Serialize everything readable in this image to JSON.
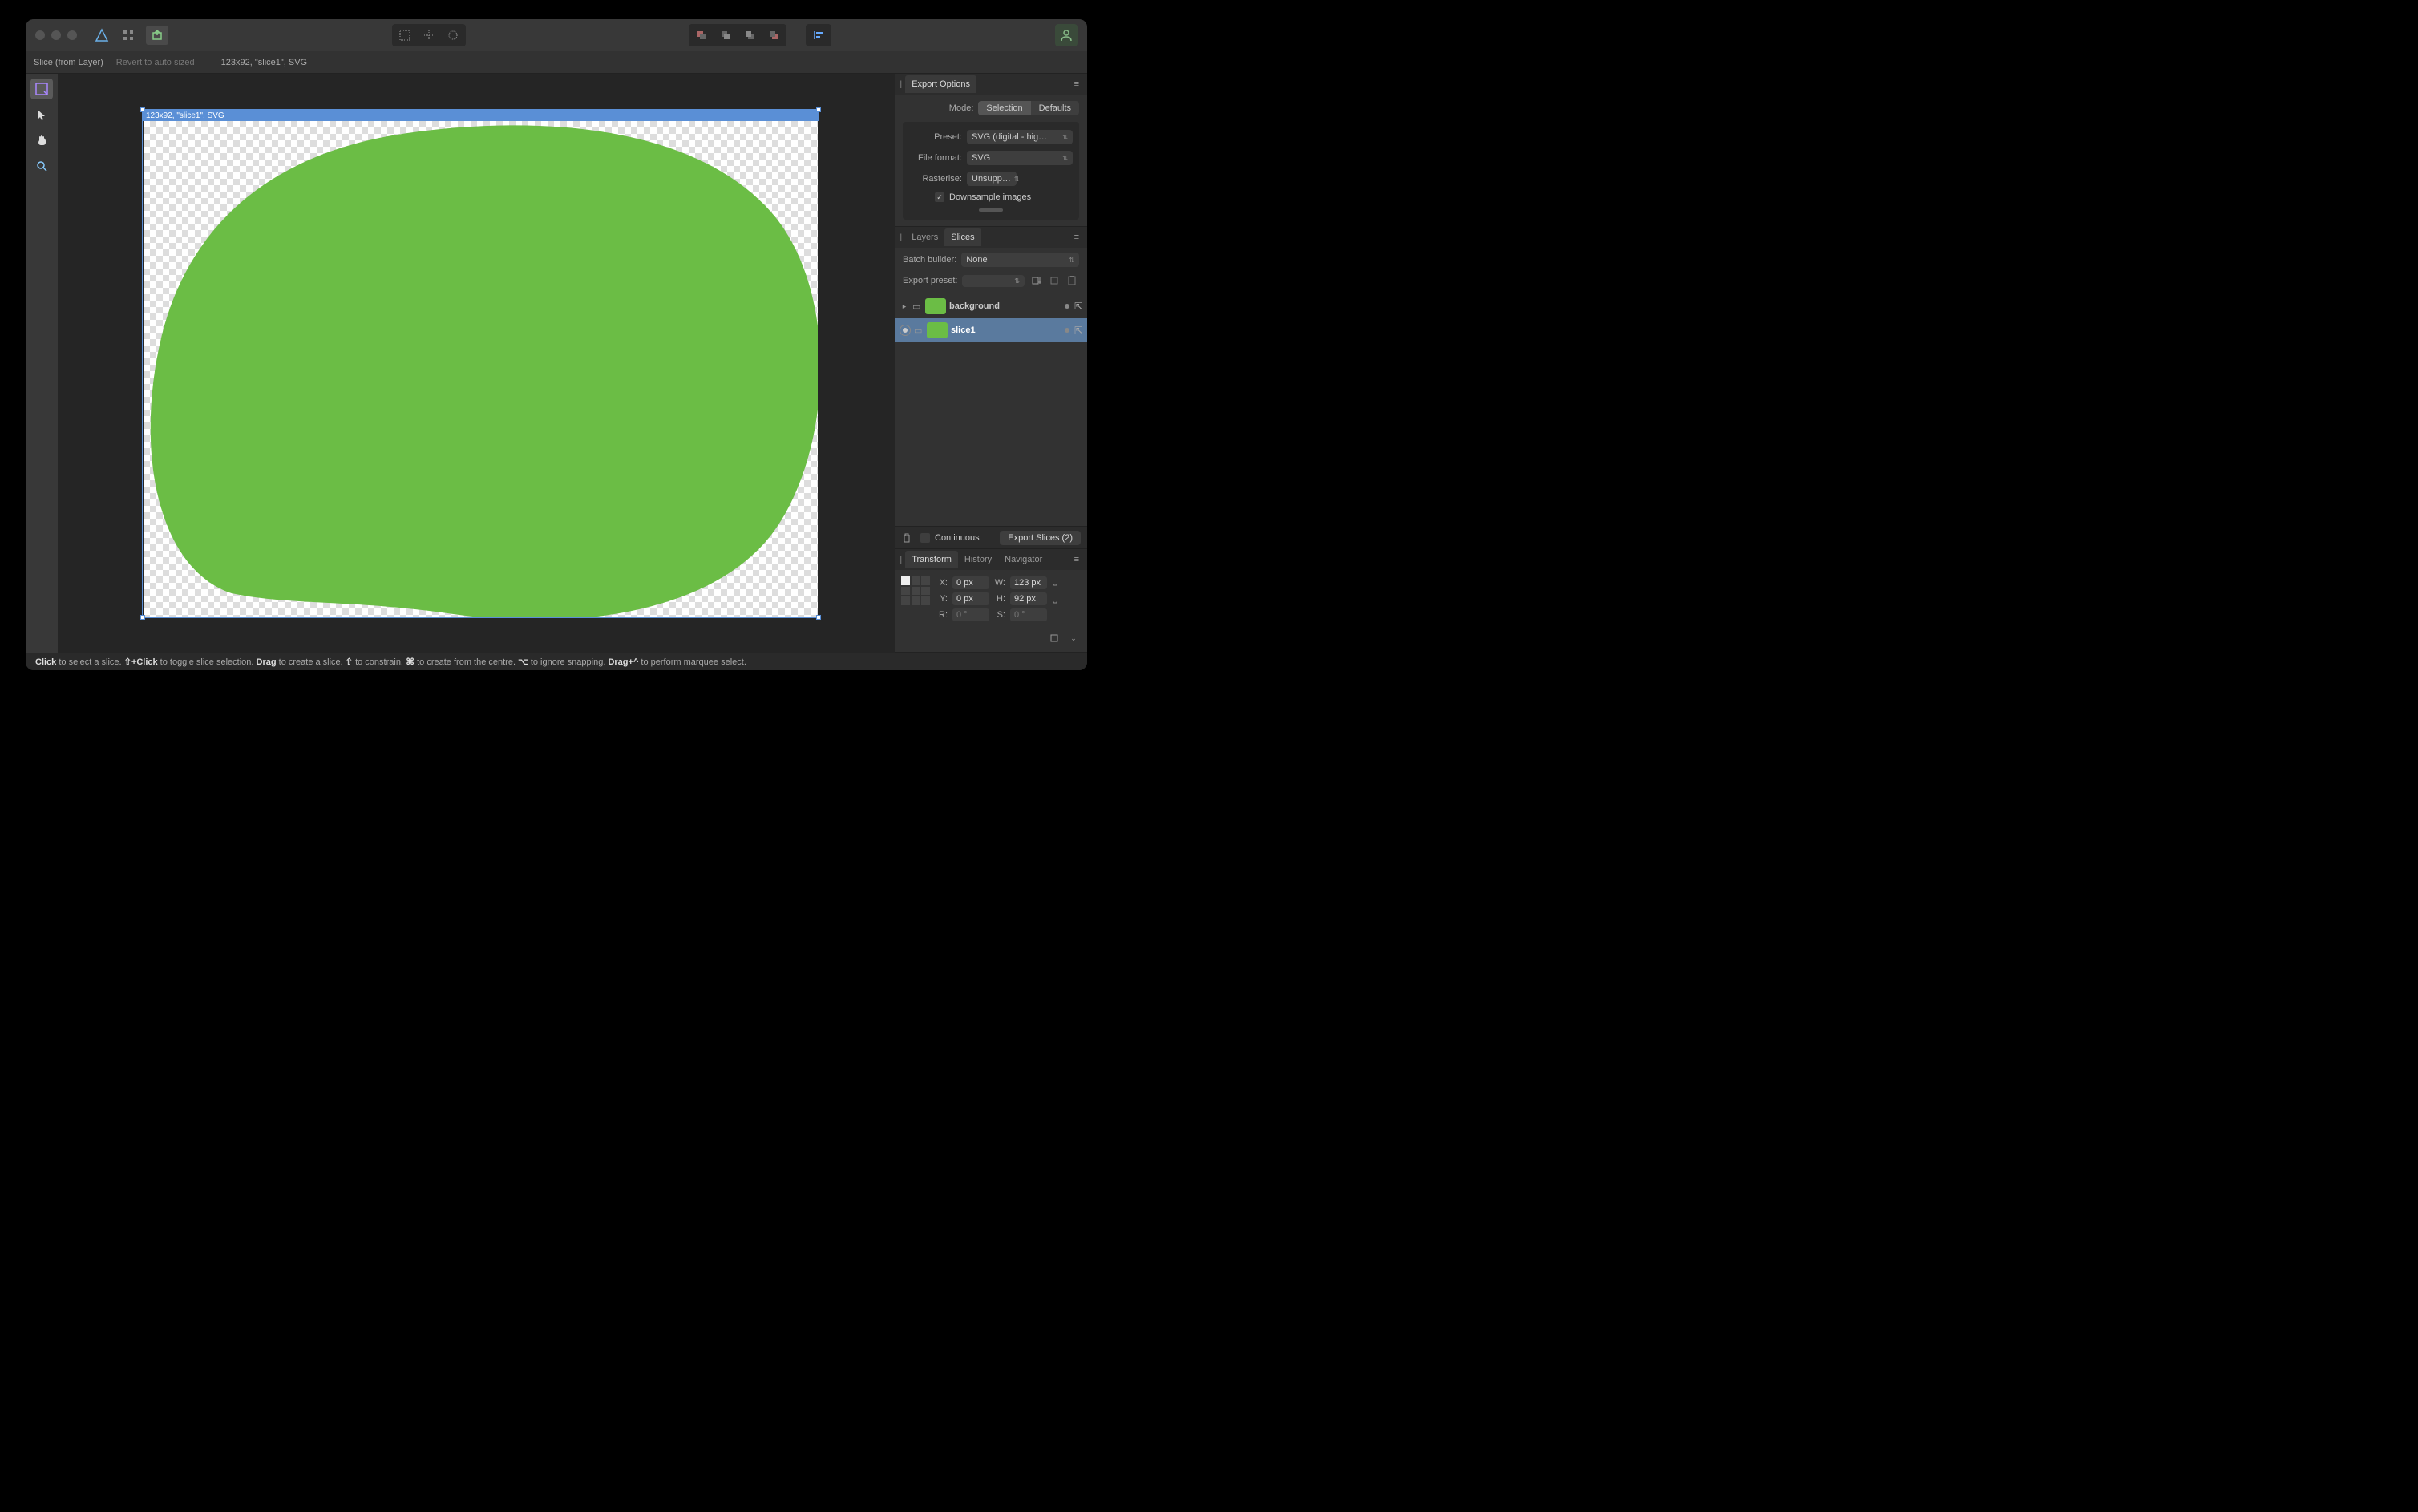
{
  "context": {
    "tool_name": "Slice (from Layer)",
    "revert_label": "Revert to auto sized",
    "info": "123x92, \"slice1\", SVG"
  },
  "canvas": {
    "slice_label": "123x92, \"slice1\", SVG"
  },
  "export_options": {
    "tab_label": "Export Options",
    "mode_label": "Mode:",
    "mode_selection": "Selection",
    "mode_defaults": "Defaults",
    "preset_label": "Preset:",
    "preset_value": "SVG (digital - hig…",
    "file_format_label": "File format:",
    "file_format_value": "SVG",
    "rasterise_label": "Rasterise:",
    "rasterise_value": "Unsupp…",
    "downsample_label": "Downsample images"
  },
  "slices_panel": {
    "tab_layers": "Layers",
    "tab_slices": "Slices",
    "batch_builder_label": "Batch builder:",
    "batch_builder_value": "None",
    "export_preset_label": "Export preset:",
    "items": [
      {
        "name": "background"
      },
      {
        "name": "slice1"
      }
    ],
    "continuous_label": "Continuous",
    "export_button": "Export Slices (2)"
  },
  "transform": {
    "tab_transform": "Transform",
    "tab_history": "History",
    "tab_navigator": "Navigator",
    "x_label": "X:",
    "x_value": "0 px",
    "y_label": "Y:",
    "y_value": "0 px",
    "w_label": "W:",
    "w_value": "123 px",
    "h_label": "H:",
    "h_value": "92 px",
    "r_label": "R:",
    "r_value": "0 °",
    "s_label": "S:",
    "s_value": "0 °"
  },
  "status": {
    "click": "Click",
    "click_text": " to select a slice. ",
    "shift_click": "⇧+Click",
    "shift_click_text": " to toggle slice selection. ",
    "drag": "Drag",
    "drag_text": " to create a slice. ",
    "shift": "⇧",
    "shift_text": " to constrain. ",
    "cmd": "⌘",
    "cmd_text": " to create from the centre. ",
    "opt": "⌥",
    "opt_text": " to ignore snapping. ",
    "drag_ctrl": "Drag+^",
    "drag_ctrl_text": " to perform marquee select."
  }
}
